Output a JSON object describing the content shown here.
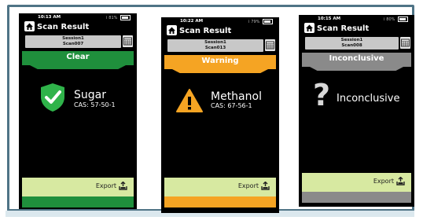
{
  "screens": [
    {
      "time": "10:13 AM",
      "battery": "81%",
      "title": "Scan Result",
      "session": "Session1",
      "scan": "Scan007",
      "banner": "Clear",
      "compound": "Sugar",
      "cas": "CAS: 57-50-1",
      "export": "Export",
      "accent": "#1f8f3c"
    },
    {
      "time": "10:22 AM",
      "battery": "79%",
      "title": "Scan Result",
      "session": "Session1",
      "scan": "Scan013",
      "banner": "Warning",
      "compound": "Methanol",
      "cas": "CAS: 67-56-1",
      "export": "Export",
      "accent": "#f5a423"
    },
    {
      "time": "10:15 AM",
      "battery": "80%",
      "title": "Scan Result",
      "session": "Session1",
      "scan": "Scan008",
      "banner": "Inconclusive",
      "compound": "Inconclusive",
      "export": "Export",
      "accent": "#8a8a8a"
    }
  ],
  "icons": [
    "home-icon",
    "calendar-icon",
    "shield-check-icon",
    "warning-triangle-icon",
    "question-mark-icon",
    "export-icon",
    "wifi-icon",
    "battery-icon"
  ]
}
